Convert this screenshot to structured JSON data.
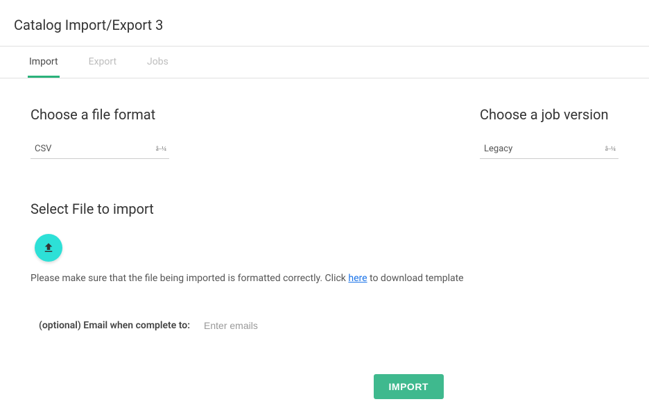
{
  "page": {
    "title": "Catalog Import/Export 3"
  },
  "tabs": {
    "import": "Import",
    "export": "Export",
    "jobs": "Jobs"
  },
  "fileFormat": {
    "label": "Choose a file format",
    "value": "CSV",
    "caret": "â–¼"
  },
  "jobVersion": {
    "label": "Choose a job version",
    "value": "Legacy",
    "caret": "â–¼"
  },
  "selectFile": {
    "label": "Select File to import",
    "helper_pre": "Please make sure that the file being imported is formatted correctly. Click ",
    "helper_link": "here",
    "helper_post": " to download template"
  },
  "email": {
    "label": "(optional) Email when complete to:",
    "placeholder": "Enter emails",
    "value": ""
  },
  "actions": {
    "import": "IMPORT"
  }
}
